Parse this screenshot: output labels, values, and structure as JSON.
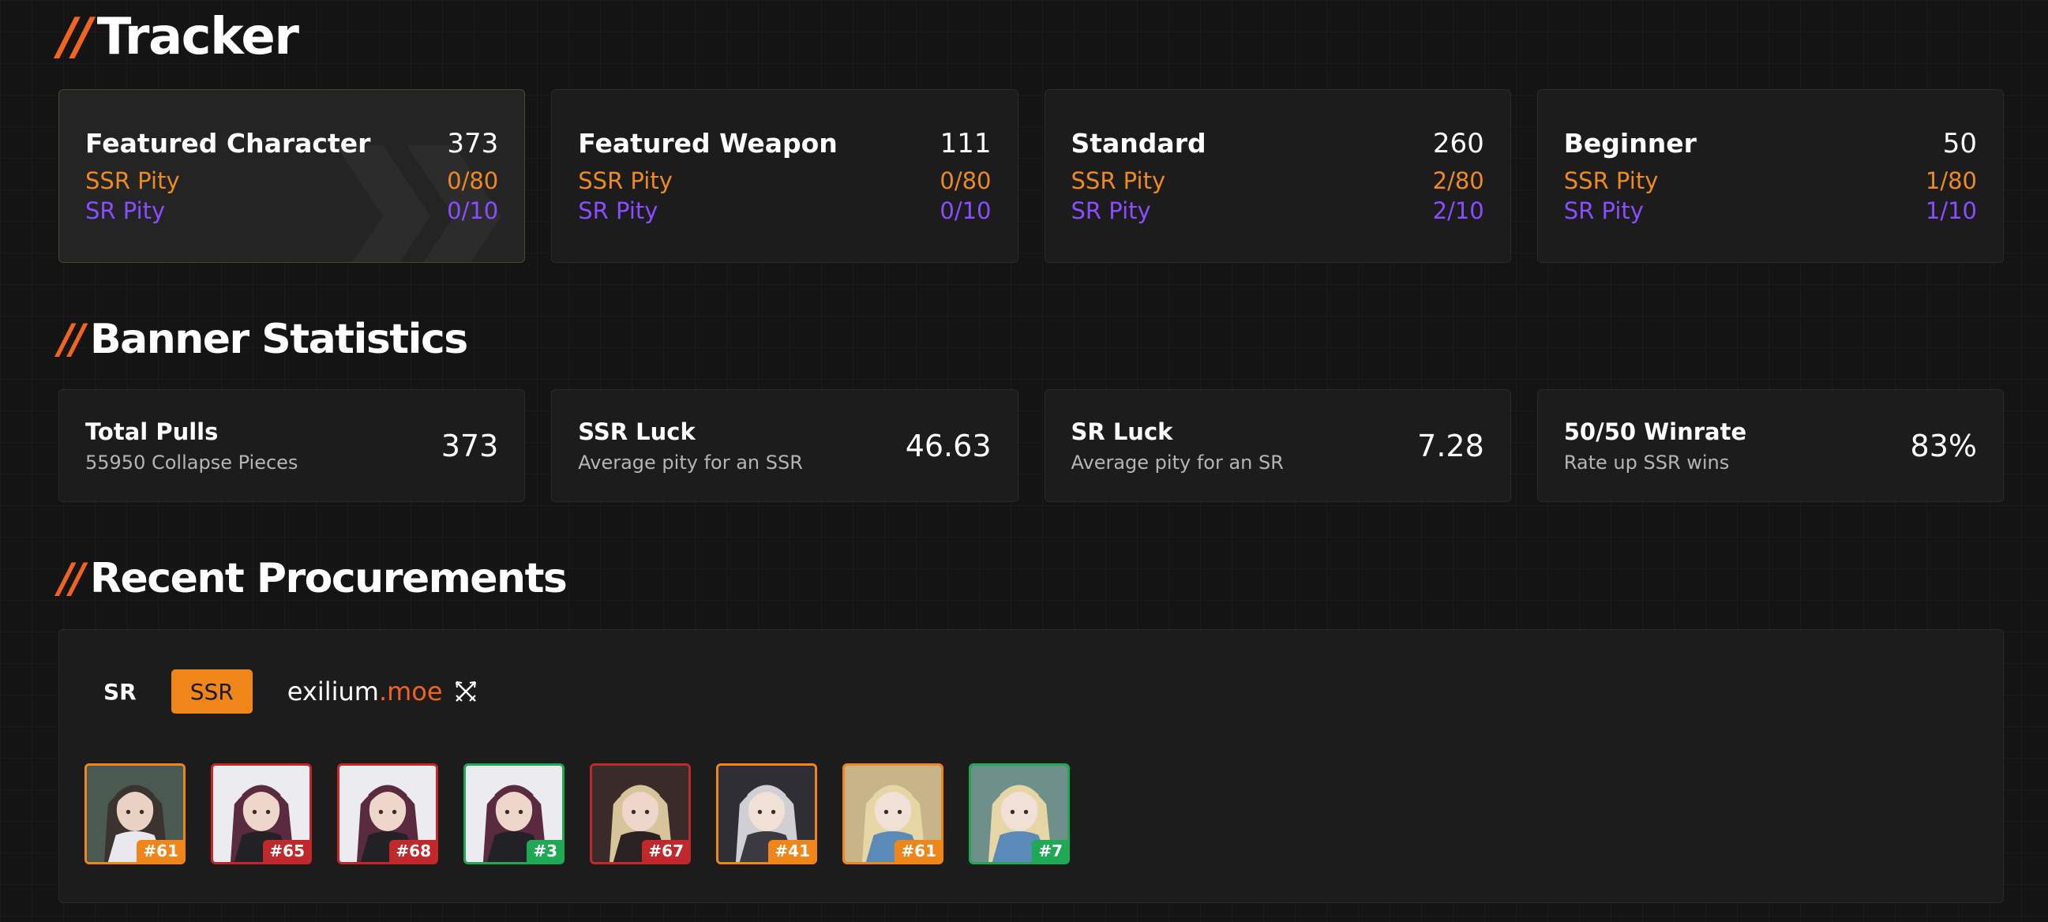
{
  "sections": {
    "tracker": "Tracker",
    "stats": "Banner Statistics",
    "recent": "Recent Procurements",
    "slash": "//"
  },
  "tracker": [
    {
      "name": "Featured Character",
      "total": "373",
      "ssr_label": "SSR Pity",
      "ssr": "0/80",
      "sr_label": "SR Pity",
      "sr": "0/10"
    },
    {
      "name": "Featured Weapon",
      "total": "111",
      "ssr_label": "SSR Pity",
      "ssr": "0/80",
      "sr_label": "SR Pity",
      "sr": "0/10"
    },
    {
      "name": "Standard",
      "total": "260",
      "ssr_label": "SSR Pity",
      "ssr": "2/80",
      "sr_label": "SR Pity",
      "sr": "2/10"
    },
    {
      "name": "Beginner",
      "total": "50",
      "ssr_label": "SSR Pity",
      "ssr": "1/80",
      "sr_label": "SR Pity",
      "sr": "1/10"
    }
  ],
  "stats": [
    {
      "label": "Total Pulls",
      "sub": "55950 Collapse Pieces",
      "value": "373"
    },
    {
      "label": "SSR Luck",
      "sub": "Average pity for an SSR",
      "value": "46.63"
    },
    {
      "label": "SR Luck",
      "sub": "Average pity for an SR",
      "value": "7.28"
    },
    {
      "label": "50/50 Winrate",
      "sub": "Rate up SSR wins",
      "value": "83%"
    }
  ],
  "filters": {
    "sr": "SR",
    "ssr": "SSR"
  },
  "brand": {
    "name": "exilium",
    "tld": ".moe",
    "icon": "crossed-swords-icon"
  },
  "recent": [
    {
      "badge": "#61",
      "rarity": "gold"
    },
    {
      "badge": "#65",
      "rarity": "red"
    },
    {
      "badge": "#68",
      "rarity": "red"
    },
    {
      "badge": "#3",
      "rarity": "green"
    },
    {
      "badge": "#67",
      "rarity": "red"
    },
    {
      "badge": "#41",
      "rarity": "gold"
    },
    {
      "badge": "#61",
      "rarity": "gold"
    },
    {
      "badge": "#7",
      "rarity": "green"
    }
  ],
  "colors": {
    "accent": "#f0641e",
    "ssr": "#f08a1e",
    "sr": "#8a4dff",
    "win": "#1fa955",
    "lose": "#c0282c"
  }
}
